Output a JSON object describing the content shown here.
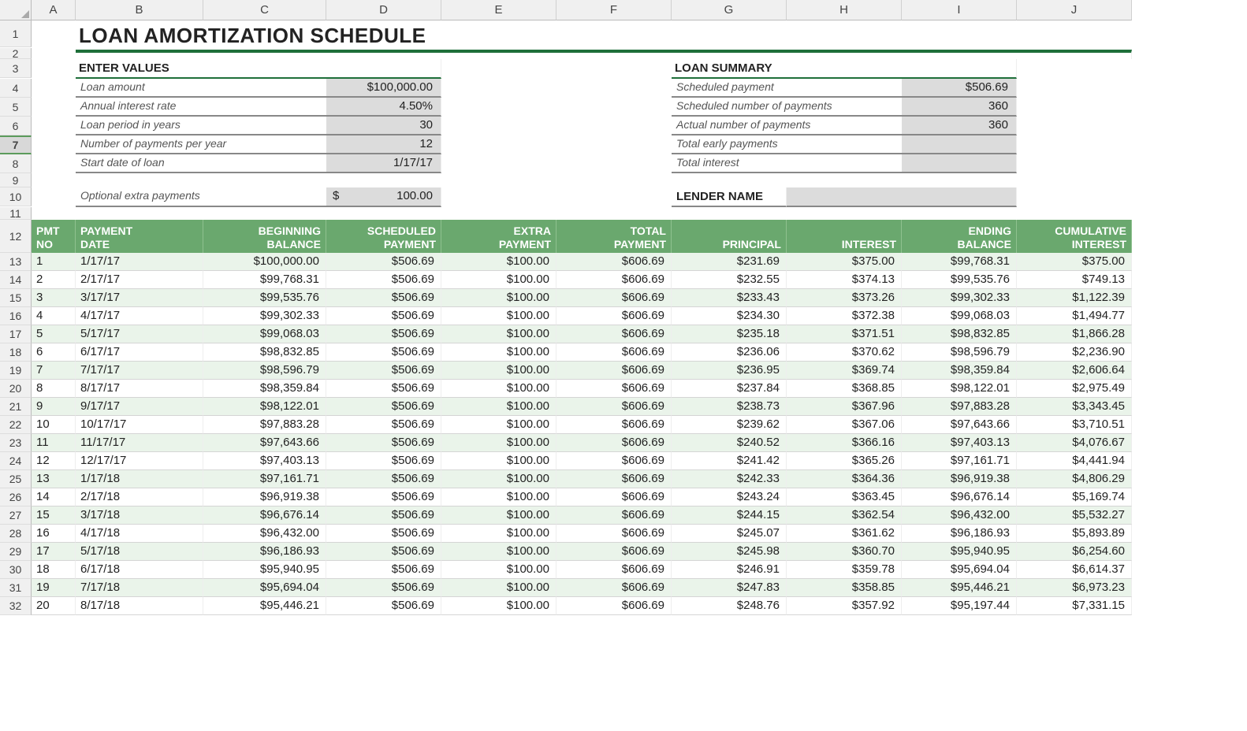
{
  "columns": [
    "A",
    "B",
    "C",
    "D",
    "E",
    "F",
    "G",
    "H",
    "I",
    "J"
  ],
  "title": "LOAN AMORTIZATION SCHEDULE",
  "enter_values": {
    "heading": "ENTER VALUES",
    "rows": [
      {
        "label": "Loan amount",
        "value": "$100,000.00"
      },
      {
        "label": "Annual interest rate",
        "value": "4.50%"
      },
      {
        "label": "Loan period in years",
        "value": "30"
      },
      {
        "label": "Number of payments per year",
        "value": "12"
      },
      {
        "label": "Start date of loan",
        "value": "1/17/17"
      }
    ],
    "extra_label": "Optional extra payments",
    "extra_currency": "$",
    "extra_value": "100.00"
  },
  "loan_summary": {
    "heading": "LOAN SUMMARY",
    "rows": [
      {
        "label": "Scheduled payment",
        "value": "$506.69"
      },
      {
        "label": "Scheduled number of payments",
        "value": "360"
      },
      {
        "label": "Actual number of payments",
        "value": "360"
      },
      {
        "label": "Total early payments",
        "value": ""
      },
      {
        "label": "Total interest",
        "value": ""
      }
    ],
    "lender_label": "LENDER NAME",
    "lender_value": ""
  },
  "table": {
    "headers": {
      "pmt_no_1": "PMT",
      "pmt_no_2": "NO",
      "payment_date_1": "PAYMENT",
      "payment_date_2": "DATE",
      "beginning_balance_1": "BEGINNING",
      "beginning_balance_2": "BALANCE",
      "scheduled_payment_1": "SCHEDULED",
      "scheduled_payment_2": "PAYMENT",
      "extra_payment_1": "EXTRA",
      "extra_payment_2": "PAYMENT",
      "total_payment_1": "TOTAL",
      "total_payment_2": "PAYMENT",
      "principal": "PRINCIPAL",
      "interest": "INTEREST",
      "ending_balance_1": "ENDING",
      "ending_balance_2": "BALANCE",
      "cumulative_interest_1": "CUMULATIVE",
      "cumulative_interest_2": "INTEREST"
    },
    "rows": [
      {
        "no": "1",
        "date": "1/17/17",
        "beg": "$100,000.00",
        "sched": "$506.69",
        "extra": "$100.00",
        "total": "$606.69",
        "principal": "$231.69",
        "interest": "$375.00",
        "end": "$99,768.31",
        "cum": "$375.00"
      },
      {
        "no": "2",
        "date": "2/17/17",
        "beg": "$99,768.31",
        "sched": "$506.69",
        "extra": "$100.00",
        "total": "$606.69",
        "principal": "$232.55",
        "interest": "$374.13",
        "end": "$99,535.76",
        "cum": "$749.13"
      },
      {
        "no": "3",
        "date": "3/17/17",
        "beg": "$99,535.76",
        "sched": "$506.69",
        "extra": "$100.00",
        "total": "$606.69",
        "principal": "$233.43",
        "interest": "$373.26",
        "end": "$99,302.33",
        "cum": "$1,122.39"
      },
      {
        "no": "4",
        "date": "4/17/17",
        "beg": "$99,302.33",
        "sched": "$506.69",
        "extra": "$100.00",
        "total": "$606.69",
        "principal": "$234.30",
        "interest": "$372.38",
        "end": "$99,068.03",
        "cum": "$1,494.77"
      },
      {
        "no": "5",
        "date": "5/17/17",
        "beg": "$99,068.03",
        "sched": "$506.69",
        "extra": "$100.00",
        "total": "$606.69",
        "principal": "$235.18",
        "interest": "$371.51",
        "end": "$98,832.85",
        "cum": "$1,866.28"
      },
      {
        "no": "6",
        "date": "6/17/17",
        "beg": "$98,832.85",
        "sched": "$506.69",
        "extra": "$100.00",
        "total": "$606.69",
        "principal": "$236.06",
        "interest": "$370.62",
        "end": "$98,596.79",
        "cum": "$2,236.90"
      },
      {
        "no": "7",
        "date": "7/17/17",
        "beg": "$98,596.79",
        "sched": "$506.69",
        "extra": "$100.00",
        "total": "$606.69",
        "principal": "$236.95",
        "interest": "$369.74",
        "end": "$98,359.84",
        "cum": "$2,606.64"
      },
      {
        "no": "8",
        "date": "8/17/17",
        "beg": "$98,359.84",
        "sched": "$506.69",
        "extra": "$100.00",
        "total": "$606.69",
        "principal": "$237.84",
        "interest": "$368.85",
        "end": "$98,122.01",
        "cum": "$2,975.49"
      },
      {
        "no": "9",
        "date": "9/17/17",
        "beg": "$98,122.01",
        "sched": "$506.69",
        "extra": "$100.00",
        "total": "$606.69",
        "principal": "$238.73",
        "interest": "$367.96",
        "end": "$97,883.28",
        "cum": "$3,343.45"
      },
      {
        "no": "10",
        "date": "10/17/17",
        "beg": "$97,883.28",
        "sched": "$506.69",
        "extra": "$100.00",
        "total": "$606.69",
        "principal": "$239.62",
        "interest": "$367.06",
        "end": "$97,643.66",
        "cum": "$3,710.51"
      },
      {
        "no": "11",
        "date": "11/17/17",
        "beg": "$97,643.66",
        "sched": "$506.69",
        "extra": "$100.00",
        "total": "$606.69",
        "principal": "$240.52",
        "interest": "$366.16",
        "end": "$97,403.13",
        "cum": "$4,076.67"
      },
      {
        "no": "12",
        "date": "12/17/17",
        "beg": "$97,403.13",
        "sched": "$506.69",
        "extra": "$100.00",
        "total": "$606.69",
        "principal": "$241.42",
        "interest": "$365.26",
        "end": "$97,161.71",
        "cum": "$4,441.94"
      },
      {
        "no": "13",
        "date": "1/17/18",
        "beg": "$97,161.71",
        "sched": "$506.69",
        "extra": "$100.00",
        "total": "$606.69",
        "principal": "$242.33",
        "interest": "$364.36",
        "end": "$96,919.38",
        "cum": "$4,806.29"
      },
      {
        "no": "14",
        "date": "2/17/18",
        "beg": "$96,919.38",
        "sched": "$506.69",
        "extra": "$100.00",
        "total": "$606.69",
        "principal": "$243.24",
        "interest": "$363.45",
        "end": "$96,676.14",
        "cum": "$5,169.74"
      },
      {
        "no": "15",
        "date": "3/17/18",
        "beg": "$96,676.14",
        "sched": "$506.69",
        "extra": "$100.00",
        "total": "$606.69",
        "principal": "$244.15",
        "interest": "$362.54",
        "end": "$96,432.00",
        "cum": "$5,532.27"
      },
      {
        "no": "16",
        "date": "4/17/18",
        "beg": "$96,432.00",
        "sched": "$506.69",
        "extra": "$100.00",
        "total": "$606.69",
        "principal": "$245.07",
        "interest": "$361.62",
        "end": "$96,186.93",
        "cum": "$5,893.89"
      },
      {
        "no": "17",
        "date": "5/17/18",
        "beg": "$96,186.93",
        "sched": "$506.69",
        "extra": "$100.00",
        "total": "$606.69",
        "principal": "$245.98",
        "interest": "$360.70",
        "end": "$95,940.95",
        "cum": "$6,254.60"
      },
      {
        "no": "18",
        "date": "6/17/18",
        "beg": "$95,940.95",
        "sched": "$506.69",
        "extra": "$100.00",
        "total": "$606.69",
        "principal": "$246.91",
        "interest": "$359.78",
        "end": "$95,694.04",
        "cum": "$6,614.37"
      },
      {
        "no": "19",
        "date": "7/17/18",
        "beg": "$95,694.04",
        "sched": "$506.69",
        "extra": "$100.00",
        "total": "$606.69",
        "principal": "$247.83",
        "interest": "$358.85",
        "end": "$95,446.21",
        "cum": "$6,973.23"
      },
      {
        "no": "20",
        "date": "8/17/18",
        "beg": "$95,446.21",
        "sched": "$506.69",
        "extra": "$100.00",
        "total": "$606.69",
        "principal": "$248.76",
        "interest": "$357.92",
        "end": "$95,197.44",
        "cum": "$7,331.15"
      }
    ]
  },
  "row_numbers": [
    1,
    2,
    3,
    4,
    5,
    6,
    7,
    8,
    9,
    10,
    11,
    12,
    13,
    14,
    15,
    16,
    17,
    18,
    19,
    20,
    21,
    22,
    23,
    24,
    25,
    26,
    27,
    28,
    29,
    30,
    31,
    32
  ],
  "selected_row": 7
}
